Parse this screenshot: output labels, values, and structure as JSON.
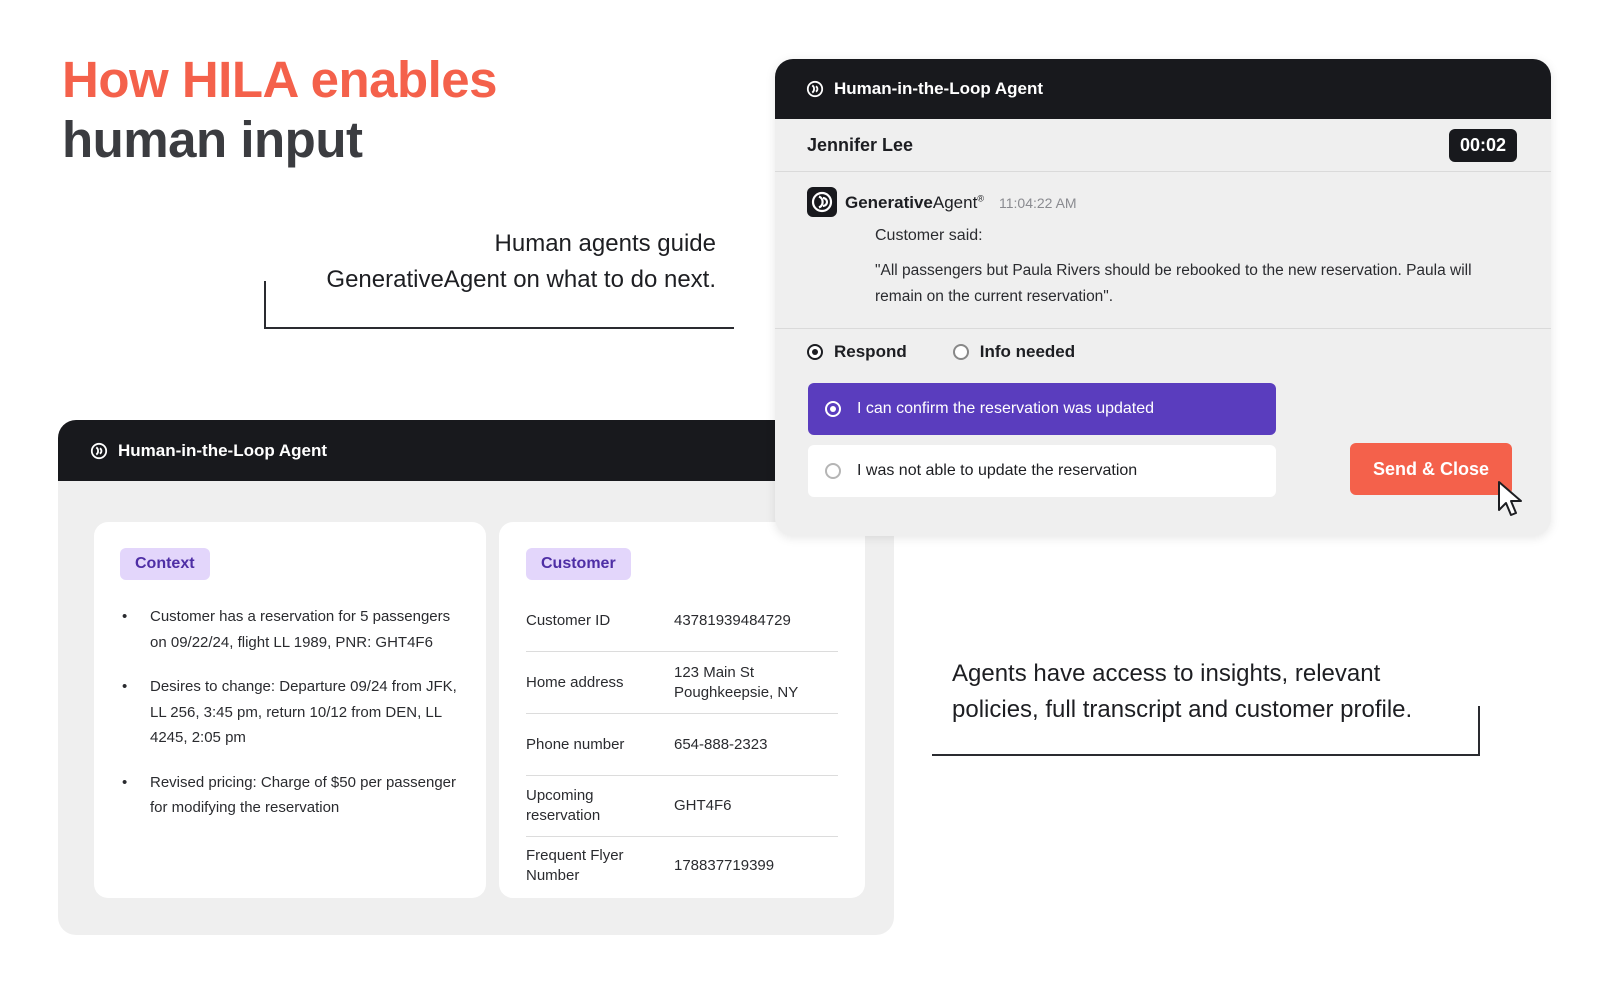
{
  "heading": {
    "line1": "How HILA enables",
    "line2": "human input"
  },
  "callouts": {
    "top_line1": "Human agents guide",
    "top_line2": "GenerativeAgent on what to do next.",
    "bottom_line1": "Agents have access to insights, relevant",
    "bottom_line2": "policies, full transcript and customer profile."
  },
  "back_panel": {
    "title": "Human-in-the-Loop Agent",
    "context": {
      "tag": "Context",
      "items": [
        "Customer has a reservation for 5 passengers on 09/22/24, flight LL 1989, PNR: GHT4F6",
        "Desires to change: Departure 09/24 from JFK, LL 256, 3:45 pm, return 10/12 from DEN, LL 4245, 2:05 pm",
        "Revised pricing: Charge of $50 per passenger for modifying the reservation"
      ]
    },
    "customer": {
      "tag": "Customer",
      "rows": [
        {
          "label": "Customer ID",
          "value": "43781939484729"
        },
        {
          "label": "Home address",
          "value": "123 Main St\nPoughkeepsie, NY"
        },
        {
          "label": "Phone number",
          "value": "654-888-2323"
        },
        {
          "label": "Upcoming reservation",
          "value": "GHT4F6"
        },
        {
          "label": "Frequent Flyer Number",
          "value": "178837719399"
        }
      ]
    }
  },
  "front_panel": {
    "title": "Human-in-the-Loop Agent",
    "agent_name": "Jennifer Lee",
    "timer": "00:02",
    "message": {
      "brand_bold": "Generative",
      "brand_light": "Agent",
      "brand_mark": "®",
      "time": "11:04:22 AM",
      "said_label": "Customer said:",
      "quote": "\"All passengers but Paula Rivers should be rebooked to the new reservation. Paula will remain on the current reservation\"."
    },
    "modes": {
      "respond": "Respond",
      "info_needed": "Info needed",
      "selected": "Respond"
    },
    "options": {
      "confirm": "I can confirm the reservation was updated",
      "not_able": "I was not able to update the reservation"
    },
    "send_label": "Send & Close"
  },
  "colors": {
    "accent_coral": "#f4614b",
    "accent_purple": "#5a3dbe",
    "tag_bg": "#e3d6fb",
    "header_dark": "#18191d"
  }
}
